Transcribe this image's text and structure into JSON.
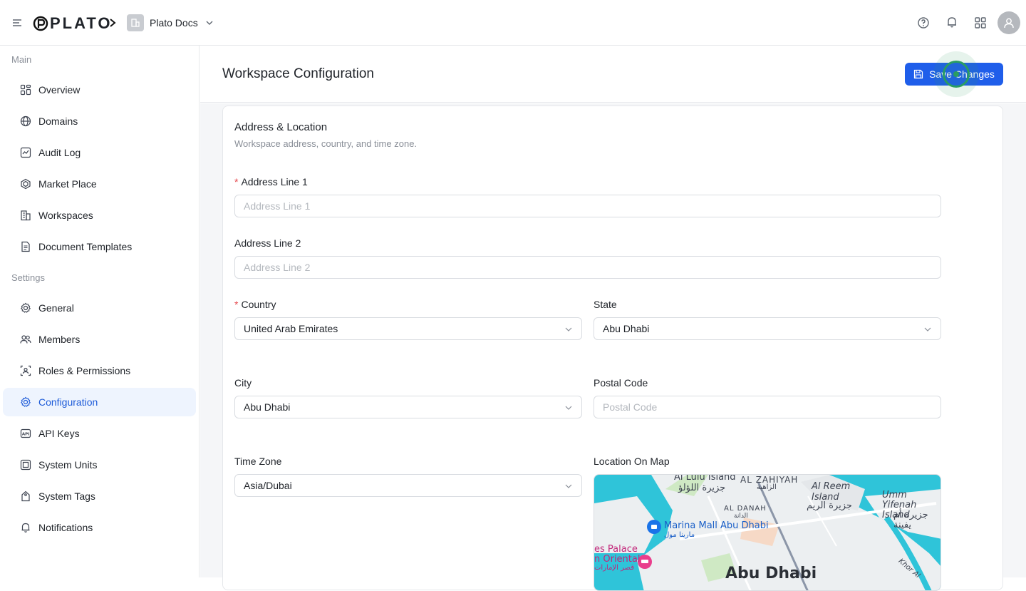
{
  "app": {
    "logo_text": "PLATO",
    "workspace_name": "Plato Docs"
  },
  "sidebar": {
    "sections": [
      {
        "label": "Main"
      },
      {
        "label": "Settings"
      }
    ],
    "items": [
      {
        "label": "Overview",
        "icon": "overview-icon"
      },
      {
        "label": "Domains",
        "icon": "globe-icon"
      },
      {
        "label": "Audit Log",
        "icon": "chart-icon"
      },
      {
        "label": "Market Place",
        "icon": "hexagon-icon"
      },
      {
        "label": "Workspaces",
        "icon": "building-icon"
      },
      {
        "label": "Document Templates",
        "icon": "document-icon"
      },
      {
        "label": "General",
        "icon": "gear-icon"
      },
      {
        "label": "Members",
        "icon": "users-icon"
      },
      {
        "label": "Roles & Permissions",
        "icon": "roles-icon"
      },
      {
        "label": "Configuration",
        "icon": "config-icon",
        "active": true
      },
      {
        "label": "API Keys",
        "icon": "api-icon"
      },
      {
        "label": "System Units",
        "icon": "units-icon"
      },
      {
        "label": "System Tags",
        "icon": "tag-icon"
      },
      {
        "label": "Notifications",
        "icon": "bell-icon"
      }
    ]
  },
  "page": {
    "title": "Workspace Configuration",
    "save_label": "Save Changes"
  },
  "card": {
    "title": "Address & Location",
    "subtitle": "Workspace address, country, and time zone."
  },
  "form": {
    "address1": {
      "label": "Address Line 1",
      "required": true,
      "placeholder": "Address Line 1",
      "value": ""
    },
    "address2": {
      "label": "Address Line 2",
      "placeholder": "Address Line 2",
      "value": ""
    },
    "country": {
      "label": "Country",
      "required": true,
      "value": "United Arab Emirates"
    },
    "state": {
      "label": "State",
      "value": "Abu Dhabi"
    },
    "city": {
      "label": "City",
      "value": "Abu Dhabi"
    },
    "postal": {
      "label": "Postal Code",
      "placeholder": "Postal Code",
      "value": ""
    },
    "timezone": {
      "label": "Time Zone",
      "value": "Asia/Dubai"
    },
    "map_label": "Location On Map"
  },
  "map": {
    "labels": {
      "al_lulu_en": "Al Lulu Island",
      "al_lulu_ar": "جزيرة اللؤلؤ",
      "al_zahiyah": "AL ZAHIYAH",
      "al_zahiyah_ar": "الزاهية",
      "al_reem_en": "Al Reem Island",
      "al_reem_ar": "جزيرة الريم",
      "umm_en": "Umm Yifenah Island",
      "umm_ar": "جزيرة أم يفينة",
      "al_danah": "AL DANAH",
      "al_danah_ar": "الدانة",
      "marina_mall_en": "Marina Mall Abu Dhabi",
      "marina_mall_ar": "مارينا مول",
      "palace_en": "es Palace",
      "oriental": "n Oriental",
      "palace_ar": "قصر الإمارات",
      "khor": "Khor Al",
      "abu_dhabi": "Abu Dhabi"
    }
  },
  "colors": {
    "primary": "#1f5eea",
    "active_bg": "#eef4fe",
    "active_text": "#1c5ad8",
    "required": "#e5484d",
    "water": "#2fc4d9"
  }
}
